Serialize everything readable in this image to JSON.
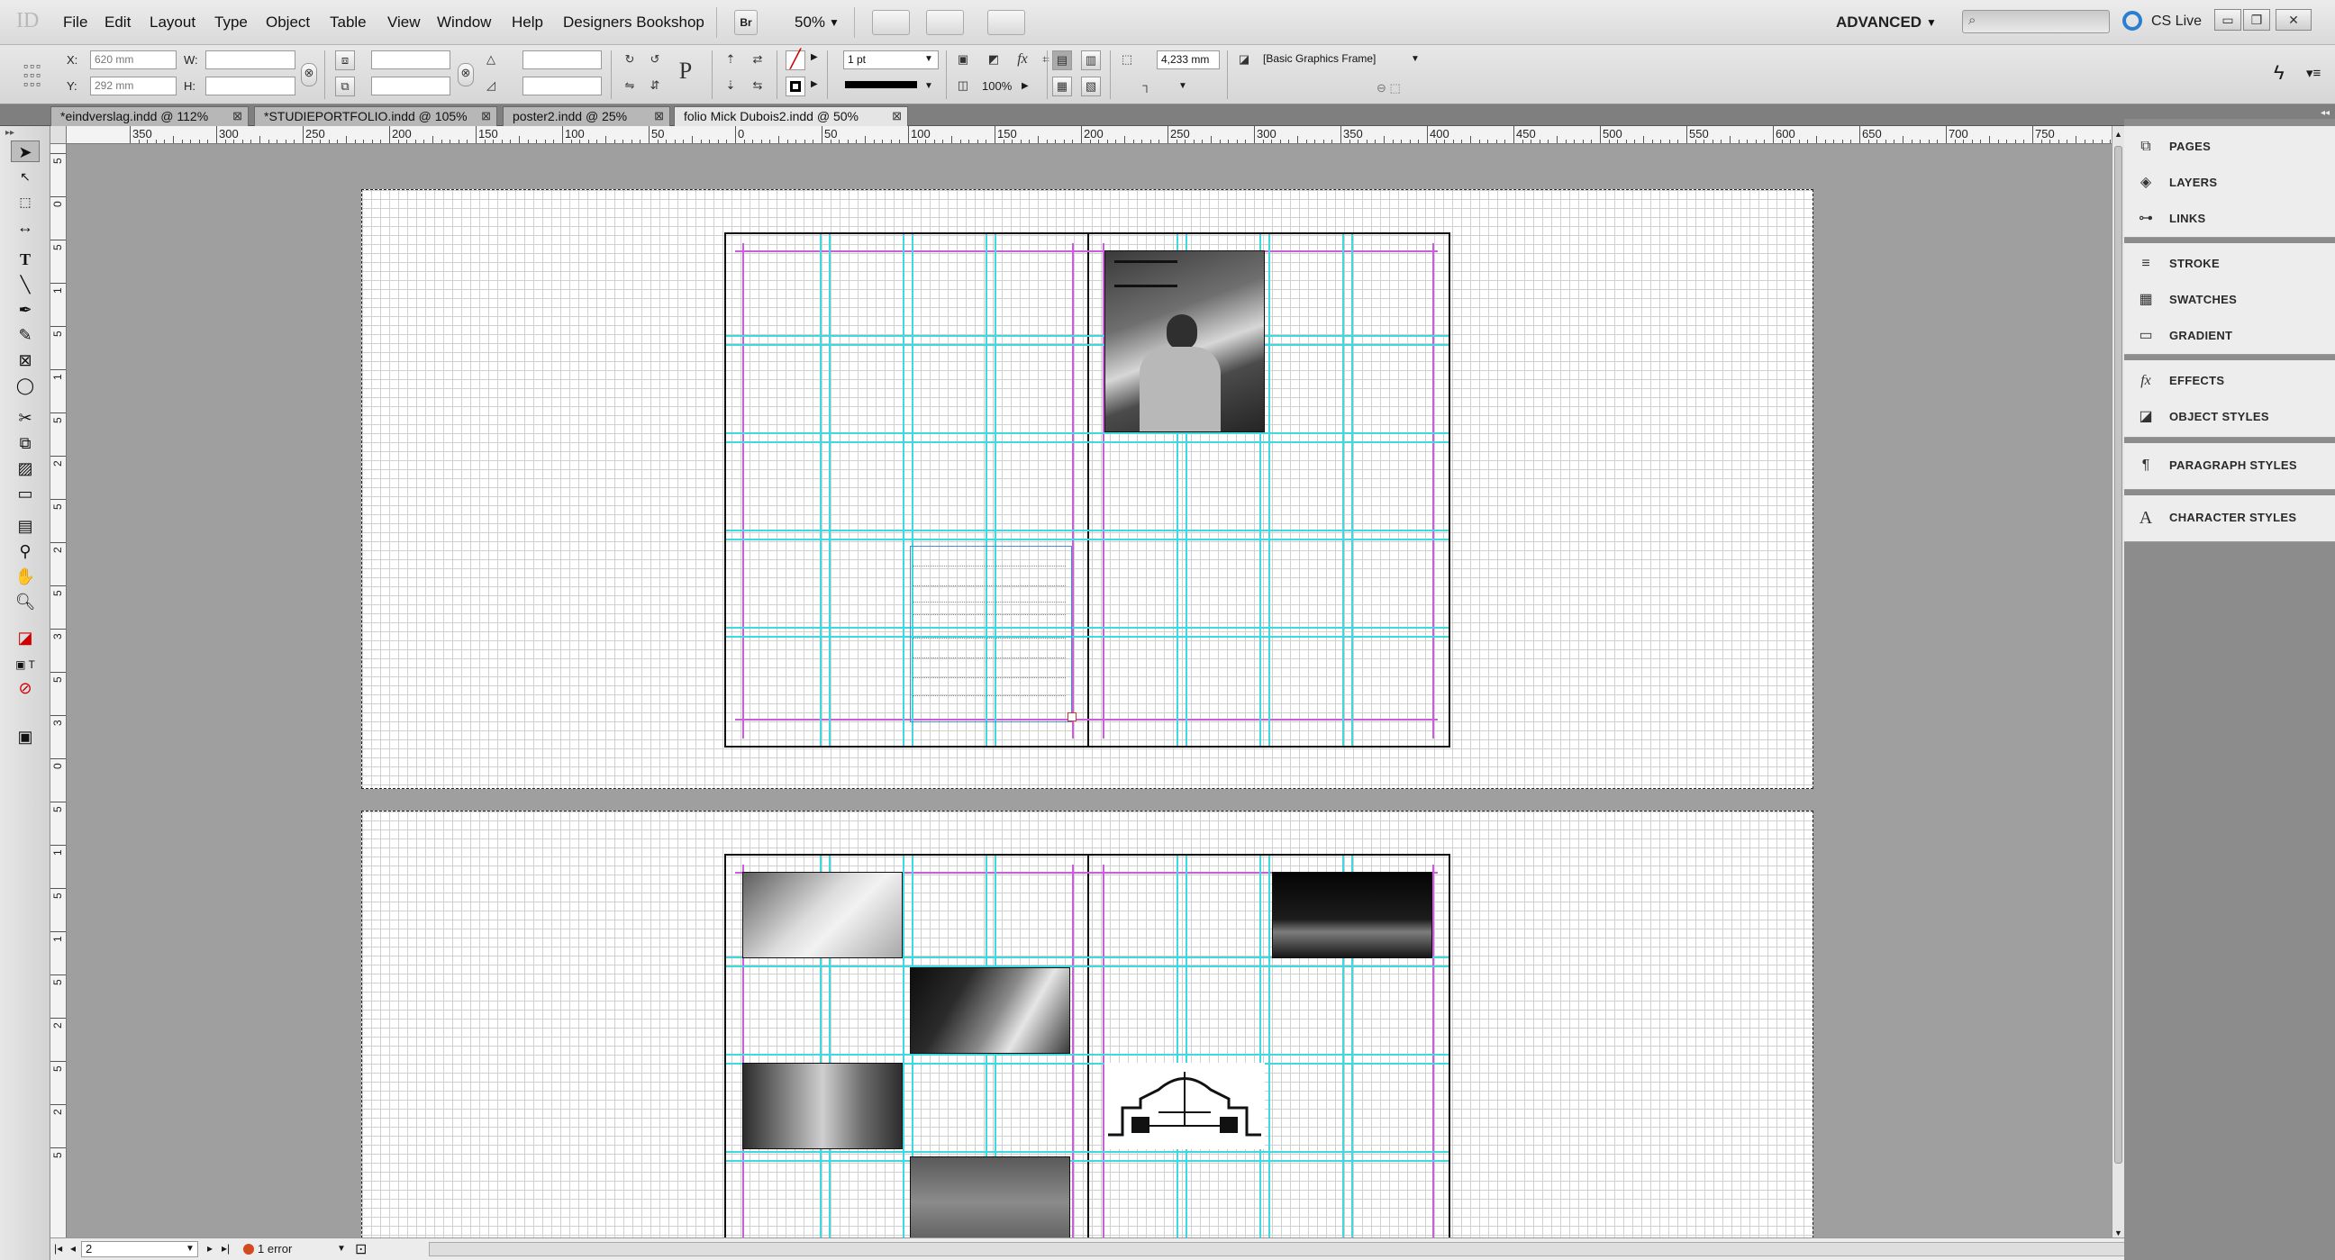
{
  "app": {
    "logo": "ID"
  },
  "menu": [
    "File",
    "Edit",
    "Layout",
    "Type",
    "Object",
    "Table",
    "View",
    "Window",
    "Help",
    "Designers Bookshop"
  ],
  "toolbar_top": {
    "bridge_label": "Br",
    "zoom": "50%",
    "workspace": "ADVANCED",
    "search_placeholder": "",
    "cs_live": "CS Live"
  },
  "control_panel": {
    "x_label": "X:",
    "x_value": "620 mm",
    "y_label": "Y:",
    "y_value": "292 mm",
    "w_label": "W:",
    "w_value": "",
    "h_label": "H:",
    "h_value": "",
    "stroke_weight": "1 pt",
    "opacity": "100%",
    "offset_value": "4,233 mm",
    "object_style": "[Basic Graphics Frame]"
  },
  "tabs": [
    {
      "label": "*eindverslag.indd @ 112%"
    },
    {
      "label": "*STUDIEPORTFOLIO.indd @ 105%"
    },
    {
      "label": "poster2.indd @ 25%"
    },
    {
      "label": "folio Mick Dubois2.indd @ 50%",
      "active": true
    }
  ],
  "ruler_top": [
    "350",
    "300",
    "250",
    "200",
    "150",
    "100",
    "50",
    "0",
    "50",
    "100",
    "150",
    "200",
    "250",
    "300",
    "350",
    "400",
    "450",
    "500",
    "550",
    "600",
    "650",
    "700",
    "750"
  ],
  "ruler_left": [
    "5",
    "0",
    "5",
    "1",
    "5",
    "1",
    "5",
    "2",
    "5",
    "2",
    "5",
    "3",
    "5",
    "3",
    "0",
    "5",
    "1",
    "5",
    "1",
    "5",
    "2",
    "5",
    "2",
    "5"
  ],
  "panels": {
    "group1": [
      {
        "icon": "pages-icon",
        "label": "PAGES"
      },
      {
        "icon": "layers-icon",
        "label": "LAYERS"
      },
      {
        "icon": "links-icon",
        "label": "LINKS"
      }
    ],
    "group2": [
      {
        "icon": "stroke-icon",
        "label": "STROKE"
      },
      {
        "icon": "swatches-icon",
        "label": "SWATCHES"
      },
      {
        "icon": "gradient-icon",
        "label": "GRADIENT"
      }
    ],
    "group3": [
      {
        "icon": "effects-icon",
        "label": "EFFECTS"
      },
      {
        "icon": "object-styles-icon",
        "label": "OBJECT STYLES"
      }
    ],
    "group4": [
      {
        "icon": "paragraph-styles-icon",
        "label": "PARAGRAPH STYLES"
      }
    ],
    "group5": [
      {
        "icon": "character-styles-icon",
        "label": "CHARACTER STYLES"
      }
    ]
  },
  "status": {
    "page": "2",
    "errors": "1 error"
  },
  "colors": {
    "margin": "#c85fd8",
    "guide": "#3fd8dd",
    "error": "#d44a1f"
  }
}
